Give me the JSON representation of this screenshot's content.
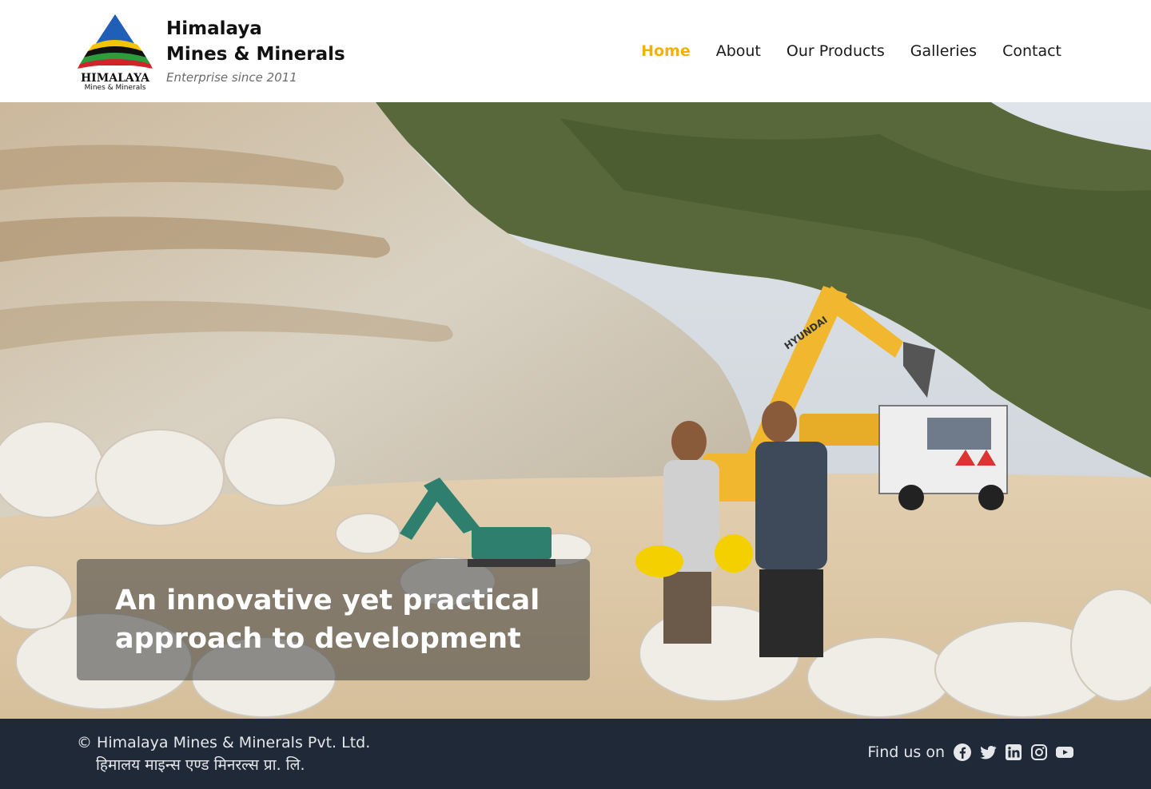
{
  "header": {
    "logo_text": "HIMALAYA",
    "logo_subtext": "Mines & Minerals",
    "brand_line1": "Himalaya",
    "brand_line2": "Mines & Minerals",
    "tagline": "Enterprise since 2011"
  },
  "nav": {
    "items": [
      {
        "label": "Home",
        "active": true
      },
      {
        "label": "About",
        "active": false
      },
      {
        "label": "Our Products",
        "active": false
      },
      {
        "label": "Galleries",
        "active": false
      },
      {
        "label": "Contact",
        "active": false
      }
    ]
  },
  "hero": {
    "caption_line1": "An innovative yet practical",
    "caption_line2": "approach to development",
    "excavator_brand": "HYUNDAI"
  },
  "footer": {
    "copyright": "© Himalaya Mines & Minerals Pvt. Ltd.",
    "copyright_np": "हिमालय माइन्स एण्ड मिनरल्स प्रा. लि.",
    "find_us": "Find us on",
    "social_icons": [
      "facebook-icon",
      "twitter-icon",
      "linkedin-icon",
      "instagram-icon",
      "youtube-icon"
    ]
  },
  "colors": {
    "accent": "#f0b400",
    "footer_bg": "#1f2937",
    "footer_text": "#e5e7eb"
  }
}
